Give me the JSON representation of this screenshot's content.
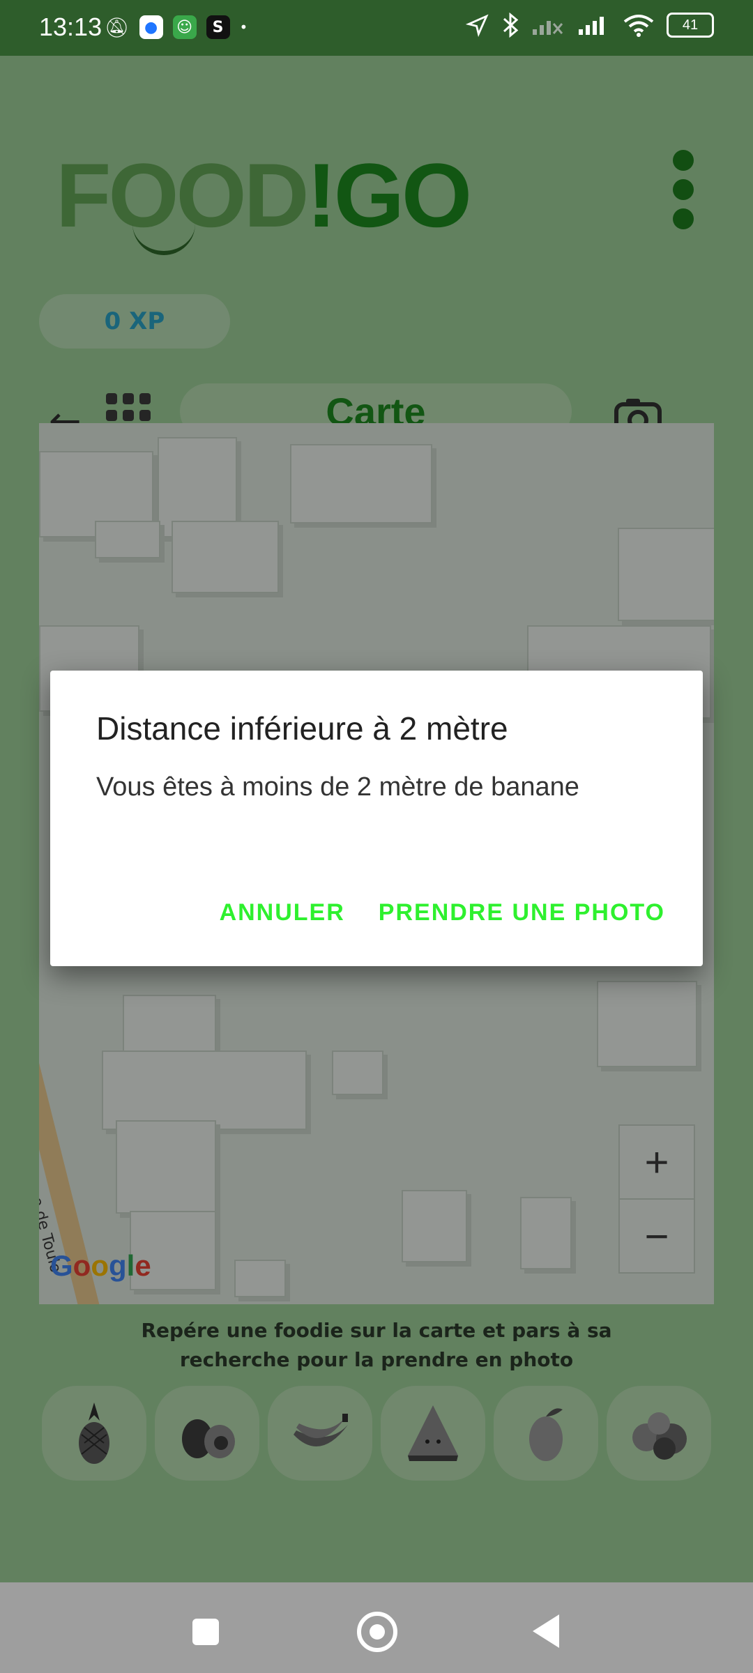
{
  "status_bar": {
    "time": "13:13",
    "battery": "41",
    "apps": [
      {
        "icon": "messages-app-icon",
        "glyph": "●",
        "color": "#1f75ff"
      },
      {
        "icon": "android-app-icon",
        "glyph": "☺",
        "color": "#3aa84a"
      },
      {
        "icon": "shazam-app-icon",
        "glyph": "S",
        "color": "#111111"
      }
    ]
  },
  "app": {
    "logo": {
      "part1": "FOOD",
      "part2": "!GO"
    },
    "xp": "0 XP",
    "page_title": "Carte"
  },
  "map": {
    "attribution": "Google",
    "street_label": "Rue de Toulo"
  },
  "hint": {
    "text": "Repére une foodie sur la carte et pars à sa recherche pour la prendre en photo"
  },
  "fruits": [
    {
      "icon": "pineapple-icon"
    },
    {
      "icon": "avocado-icon"
    },
    {
      "icon": "banana-icon"
    },
    {
      "icon": "watermelon-icon"
    },
    {
      "icon": "mango-icon"
    },
    {
      "icon": "apples-icon"
    }
  ],
  "dialog": {
    "title": "Distance inférieure à 2 mètre",
    "message": "Vous êtes à moins de 2 mètre de banane",
    "cancel_label": "ANNULER",
    "confirm_label": "PRENDRE UNE PHOTO"
  },
  "colors": {
    "brand_green": "#1e8b1f",
    "dialog_action": "#2ef02e",
    "status_bar": "#2e5d2b",
    "xp_text": "#2aa4c7"
  }
}
